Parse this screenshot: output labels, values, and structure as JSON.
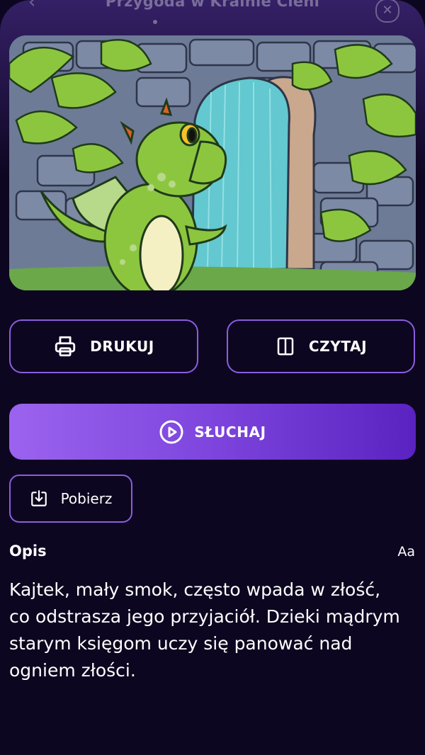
{
  "header": {
    "title": "Przygoda w Krainie Cieni",
    "back_icon": "arrow-left-icon",
    "close_icon": "close-icon"
  },
  "illustration": {
    "subject": "green-dragon-at-stone-gate"
  },
  "actions": {
    "print_label": "DRUKUJ",
    "print_icon": "printer-icon",
    "read_label": "CZYTAJ",
    "read_icon": "book-icon",
    "listen_label": "SŁUCHAJ",
    "listen_icon": "play-circle-icon",
    "download_label": "Pobierz",
    "download_icon": "download-icon"
  },
  "description": {
    "title": "Opis",
    "font_toggle": "Aa",
    "text": "Kajtek, mały smok, często wpada w złość, co odstrasza jego przyjaciół. Dzieki mądrym starym księgom uczy się panować nad ogniem złości."
  },
  "colors": {
    "background": "#0d0620",
    "accent_border": "#8a5ee0",
    "listen_gradient_start": "#9b63ee",
    "listen_gradient_end": "#5a22c0"
  }
}
